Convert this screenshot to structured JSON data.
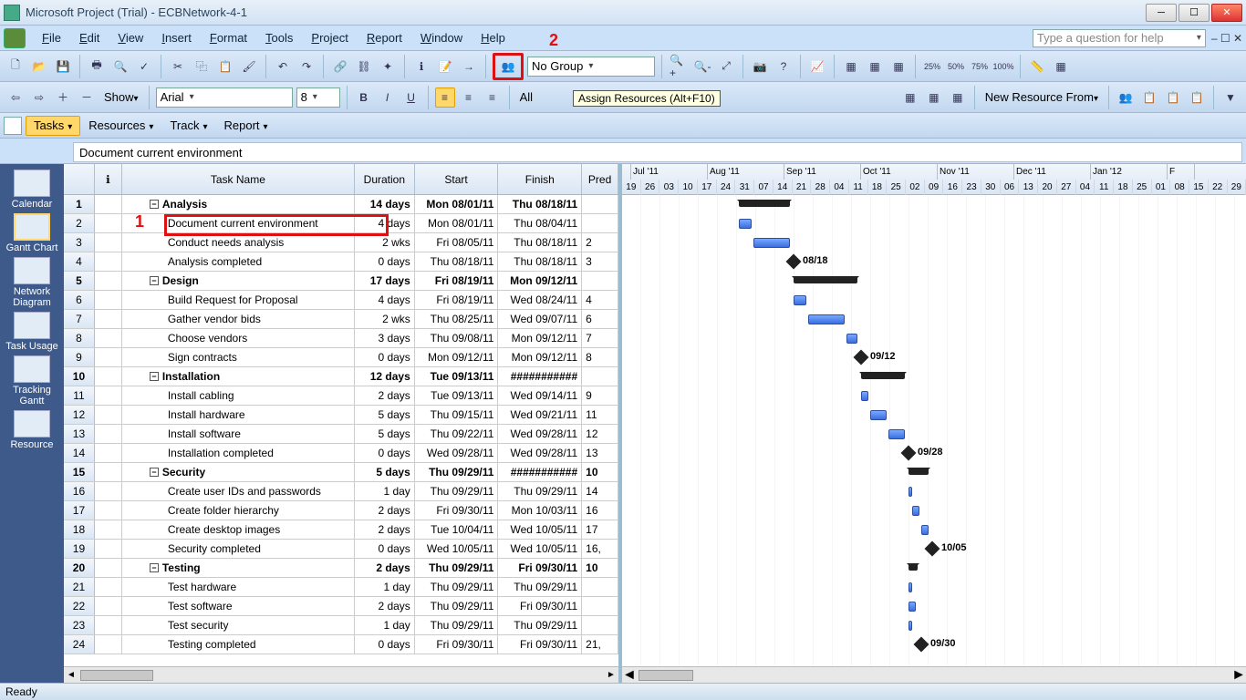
{
  "window": {
    "title": "Microsoft Project (Trial) - ECBNetwork-4-1"
  },
  "helpbox": "Type a question for help",
  "menus": [
    "File",
    "Edit",
    "View",
    "Insert",
    "Format",
    "Tools",
    "Project",
    "Report",
    "Window",
    "Help"
  ],
  "toolbar": {
    "group_filter": "No Group",
    "font": "Arial",
    "size": "8",
    "show_label": "Show",
    "all_label": "All",
    "new_resource": "New Resource From"
  },
  "viewtabs": [
    "Tasks",
    "Resources",
    "Track",
    "Report"
  ],
  "tasknamestrip": "Document current environment",
  "tooltip": "Assign Resources (Alt+F10)",
  "annotations": {
    "num1": "1",
    "num2": "2"
  },
  "sidebar": [
    {
      "label": "Calendar"
    },
    {
      "label": "Gantt Chart",
      "sel": true
    },
    {
      "label": "Network Diagram"
    },
    {
      "label": "Task Usage"
    },
    {
      "label": "Tracking Gantt"
    },
    {
      "label": "Resource"
    }
  ],
  "columns": {
    "info": "ℹ",
    "name": "Task Name",
    "dur": "Duration",
    "start": "Start",
    "fin": "Finish",
    "pred": "Pred"
  },
  "rows": [
    {
      "n": 1,
      "name": "Analysis",
      "dur": "14 days",
      "start": "Mon 08/01/11",
      "fin": "Thu 08/18/11",
      "pred": "",
      "sum": true,
      "lvl": 1
    },
    {
      "n": 2,
      "name": "Document current environment",
      "dur": "4 days",
      "start": "Mon 08/01/11",
      "fin": "Thu 08/04/11",
      "pred": "",
      "lvl": 2
    },
    {
      "n": 3,
      "name": "Conduct needs analysis",
      "dur": "2 wks",
      "start": "Fri 08/05/11",
      "fin": "Thu 08/18/11",
      "pred": "2",
      "lvl": 2
    },
    {
      "n": 4,
      "name": "Analysis completed",
      "dur": "0 days",
      "start": "Thu 08/18/11",
      "fin": "Thu 08/18/11",
      "pred": "3",
      "lvl": 2
    },
    {
      "n": 5,
      "name": "Design",
      "dur": "17 days",
      "start": "Fri 08/19/11",
      "fin": "Mon 09/12/11",
      "pred": "",
      "sum": true,
      "lvl": 1
    },
    {
      "n": 6,
      "name": "Build Request for Proposal",
      "dur": "4 days",
      "start": "Fri 08/19/11",
      "fin": "Wed 08/24/11",
      "pred": "4",
      "lvl": 2
    },
    {
      "n": 7,
      "name": "Gather vendor bids",
      "dur": "2 wks",
      "start": "Thu 08/25/11",
      "fin": "Wed 09/07/11",
      "pred": "6",
      "lvl": 2
    },
    {
      "n": 8,
      "name": "Choose vendors",
      "dur": "3 days",
      "start": "Thu 09/08/11",
      "fin": "Mon 09/12/11",
      "pred": "7",
      "lvl": 2
    },
    {
      "n": 9,
      "name": "Sign contracts",
      "dur": "0 days",
      "start": "Mon 09/12/11",
      "fin": "Mon 09/12/11",
      "pred": "8",
      "lvl": 2
    },
    {
      "n": 10,
      "name": "Installation",
      "dur": "12 days",
      "start": "Tue 09/13/11",
      "fin": "###########",
      "pred": "",
      "sum": true,
      "lvl": 1
    },
    {
      "n": 11,
      "name": "Install cabling",
      "dur": "2 days",
      "start": "Tue 09/13/11",
      "fin": "Wed 09/14/11",
      "pred": "9",
      "lvl": 2
    },
    {
      "n": 12,
      "name": "Install hardware",
      "dur": "5 days",
      "start": "Thu 09/15/11",
      "fin": "Wed 09/21/11",
      "pred": "11",
      "lvl": 2
    },
    {
      "n": 13,
      "name": "Install software",
      "dur": "5 days",
      "start": "Thu 09/22/11",
      "fin": "Wed 09/28/11",
      "pred": "12",
      "lvl": 2
    },
    {
      "n": 14,
      "name": "Installation completed",
      "dur": "0 days",
      "start": "Wed 09/28/11",
      "fin": "Wed 09/28/11",
      "pred": "13",
      "lvl": 2
    },
    {
      "n": 15,
      "name": "Security",
      "dur": "5 days",
      "start": "Thu 09/29/11",
      "fin": "###########",
      "pred": "10",
      "sum": true,
      "lvl": 1
    },
    {
      "n": 16,
      "name": "Create user IDs and passwords",
      "dur": "1 day",
      "start": "Thu 09/29/11",
      "fin": "Thu 09/29/11",
      "pred": "14",
      "lvl": 2
    },
    {
      "n": 17,
      "name": "Create folder hierarchy",
      "dur": "2 days",
      "start": "Fri 09/30/11",
      "fin": "Mon 10/03/11",
      "pred": "16",
      "lvl": 2
    },
    {
      "n": 18,
      "name": "Create desktop images",
      "dur": "2 days",
      "start": "Tue 10/04/11",
      "fin": "Wed 10/05/11",
      "pred": "17",
      "lvl": 2
    },
    {
      "n": 19,
      "name": "Security completed",
      "dur": "0 days",
      "start": "Wed 10/05/11",
      "fin": "Wed 10/05/11",
      "pred": "16,",
      "lvl": 2
    },
    {
      "n": 20,
      "name": "Testing",
      "dur": "2 days",
      "start": "Thu 09/29/11",
      "fin": "Fri 09/30/11",
      "pred": "10",
      "sum": true,
      "lvl": 1
    },
    {
      "n": 21,
      "name": "Test hardware",
      "dur": "1 day",
      "start": "Thu 09/29/11",
      "fin": "Thu 09/29/11",
      "pred": "",
      "lvl": 2
    },
    {
      "n": 22,
      "name": "Test software",
      "dur": "2 days",
      "start": "Thu 09/29/11",
      "fin": "Fri 09/30/11",
      "pred": "",
      "lvl": 2
    },
    {
      "n": 23,
      "name": "Test security",
      "dur": "1 day",
      "start": "Thu 09/29/11",
      "fin": "Thu 09/29/11",
      "pred": "",
      "lvl": 2
    },
    {
      "n": 24,
      "name": "Testing completed",
      "dur": "0 days",
      "start": "Fri 09/30/11",
      "fin": "Fri 09/30/11",
      "pred": "21,",
      "lvl": 2
    }
  ],
  "months": [
    {
      "label": "Jul '11",
      "w": 84
    },
    {
      "label": "Aug '11",
      "w": 84
    },
    {
      "label": "Sep '11",
      "w": 84
    },
    {
      "label": "Oct '11",
      "w": 84
    },
    {
      "label": "Nov '11",
      "w": 84
    },
    {
      "label": "Dec '11",
      "w": 84
    },
    {
      "label": "Jan '12",
      "w": 84
    },
    {
      "label": "F",
      "w": 30
    }
  ],
  "days": [
    "19",
    "26",
    "03",
    "10",
    "17",
    "24",
    "31",
    "07",
    "14",
    "21",
    "28",
    "04",
    "11",
    "18",
    "25",
    "02",
    "09",
    "16",
    "23",
    "30",
    "06",
    "13",
    "20",
    "27",
    "04",
    "11",
    "18",
    "25",
    "01",
    "08",
    "15",
    "22",
    "29"
  ],
  "milestones": {
    "m4": "08/18",
    "m9": "09/12",
    "m14": "09/28",
    "m19": "10/05",
    "m24": "09/30"
  },
  "status": "Ready"
}
